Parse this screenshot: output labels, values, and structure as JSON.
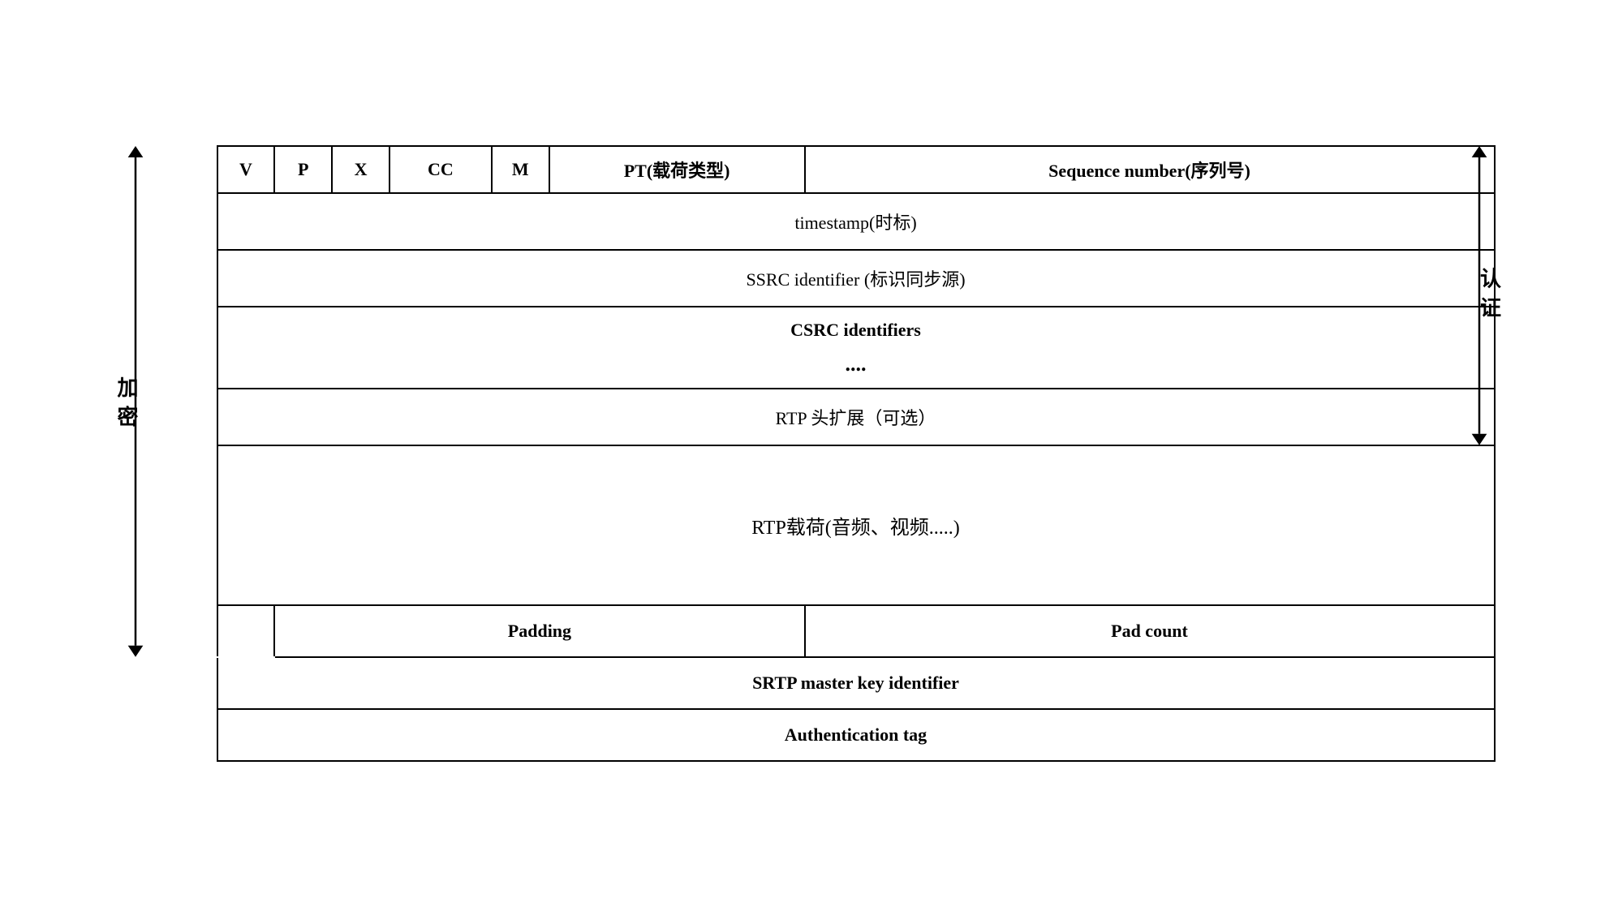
{
  "header": {
    "cols": [
      {
        "label": "V",
        "width": "4%"
      },
      {
        "label": "P",
        "width": "4%"
      },
      {
        "label": "X",
        "width": "4%"
      },
      {
        "label": "CC",
        "width": "8%"
      },
      {
        "label": "M",
        "width": "4%"
      },
      {
        "label": "PT(载荷类型)",
        "width": "20%"
      },
      {
        "label": "Sequence number(序列号)",
        "width": "56%"
      }
    ]
  },
  "rows": [
    {
      "type": "full",
      "content": "timestamp(时标)",
      "bold": false
    },
    {
      "type": "full",
      "content": "SSRC identifier (标识同步源)",
      "bold": false
    },
    {
      "type": "full-tall",
      "content": "CSRC identifiers\n....",
      "bold": false
    },
    {
      "type": "full",
      "content": "RTP 头扩展（可选）",
      "bold": false
    },
    {
      "type": "full-xlarge",
      "content": "RTP载荷(音频、视频.....)",
      "bold": false
    },
    {
      "type": "split",
      "left": "Padding",
      "right": "Pad count",
      "bold": true
    },
    {
      "type": "full",
      "content": "SRTP master key identifier",
      "bold": true
    },
    {
      "type": "full",
      "content": "Authentication tag",
      "bold": true
    }
  ],
  "left_label": "加\n密",
  "right_label": "认\n证",
  "encrypt_note": "加密",
  "auth_note": "认证"
}
